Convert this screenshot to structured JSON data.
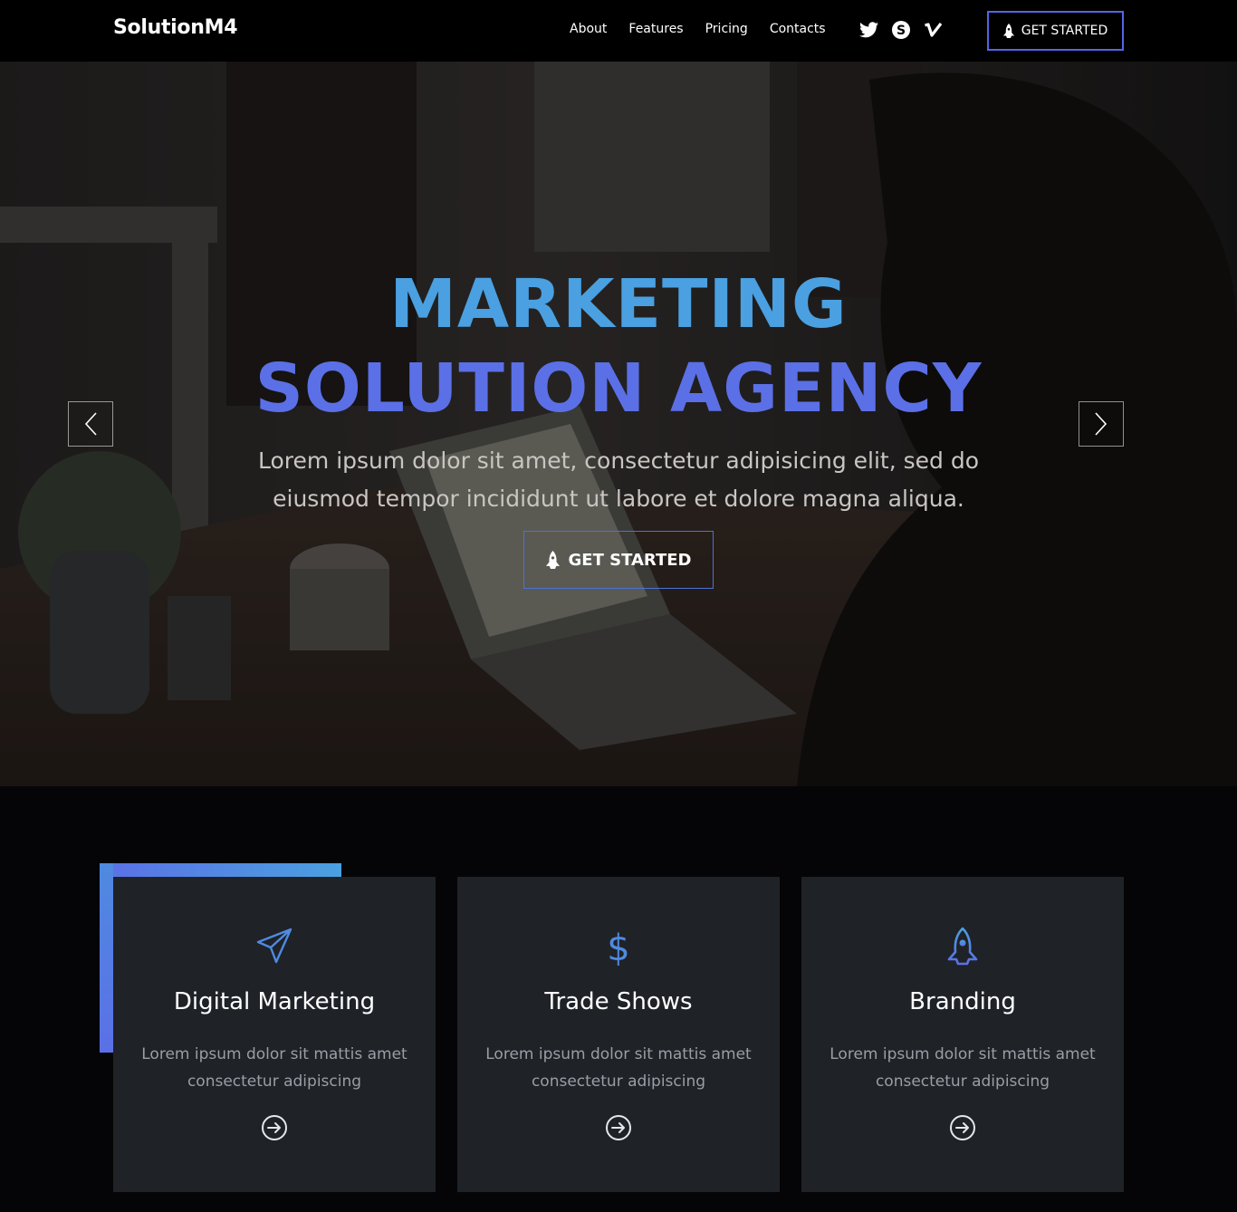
{
  "header": {
    "logo": "SolutionM4",
    "nav": [
      "About",
      "Features",
      "Pricing",
      "Contacts"
    ],
    "social": [
      "twitter-icon",
      "skype-icon",
      "vimeo-icon"
    ],
    "cta_label": "GET STARTED"
  },
  "hero": {
    "title_line1": "MARKETING",
    "title_line2": "SOLUTION AGENCY",
    "subtitle": "Lorem ipsum dolor sit amet, consectetur adipisicing elit, sed do eiusmod tempor incididunt ut labore et dolore magna aliqua.",
    "cta_label": "GET STARTED",
    "colors": {
      "title_line1": "#4aa0e0",
      "title_line2": "#5b70e6",
      "button_border": "#4b73d6"
    }
  },
  "features": [
    {
      "icon": "paper-plane-icon",
      "title": "Digital Marketing",
      "text": "Lorem ipsum dolor sit mattis amet consectetur adipiscing"
    },
    {
      "icon": "dollar-icon",
      "title": "Trade Shows",
      "text": "Lorem ipsum dolor sit mattis amet consectetur adipiscing"
    },
    {
      "icon": "rocket-icon",
      "title": "Branding",
      "text": "Lorem ipsum dolor sit mattis amet consectetur adipiscing"
    }
  ],
  "colors": {
    "accent": "#5b70e6",
    "accent_light": "#4aa0e0",
    "card_bg": "#1f2227",
    "page_bg": "#050507"
  }
}
